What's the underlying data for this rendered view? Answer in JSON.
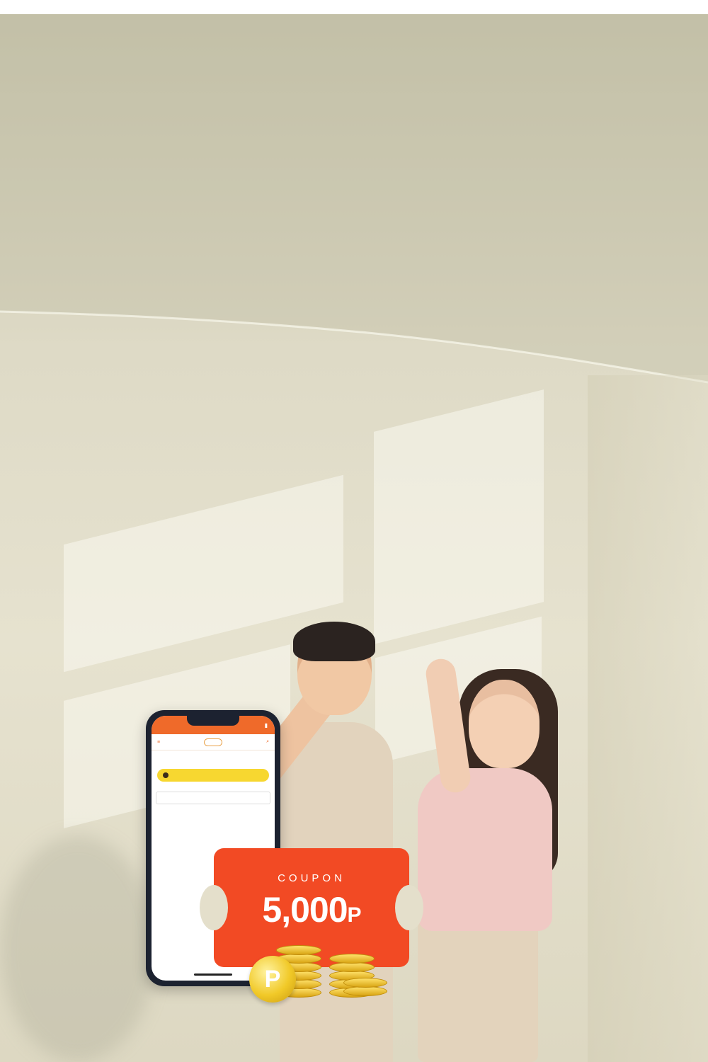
{
  "phone": {
    "status_time": "",
    "title": "",
    "subtitle_1": "",
    "subtitle_2": "",
    "button_label": "",
    "small_text": "",
    "field_text": ""
  },
  "coupon": {
    "label": "COUPON",
    "amount": "5,000",
    "unit": "P"
  },
  "point_coin": {
    "letter": "P"
  },
  "colors": {
    "coupon": "#f24a24",
    "phone_header": "#ef6a2a",
    "coin_gold": "#f1c928"
  }
}
